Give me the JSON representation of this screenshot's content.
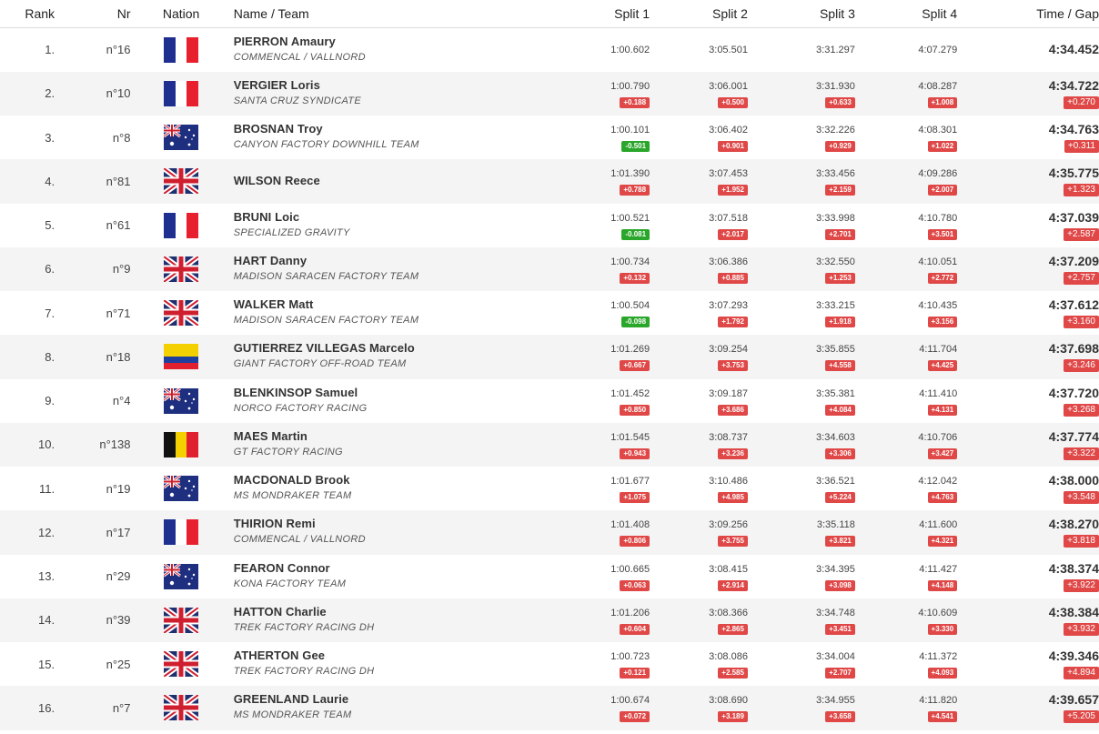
{
  "headers": {
    "rank": "Rank",
    "nr": "Nr",
    "nation": "Nation",
    "name_team": "Name / Team",
    "split1": "Split 1",
    "split2": "Split 2",
    "split3": "Split 3",
    "split4": "Split 4",
    "time_gap": "Time / Gap"
  },
  "rows": [
    {
      "rank": "1.",
      "nr": "n°16",
      "nation": "france-flag-icon",
      "name": "PIERRON Amaury",
      "team": "COMMENCAL / VALLNORD",
      "s1": "1:00.602",
      "g1": "",
      "g1_type": "",
      "s2": "3:05.501",
      "g2": "",
      "s3": "3:31.297",
      "g3": "",
      "s4": "4:07.279",
      "g4": "",
      "time": "4:34.452",
      "gap": ""
    },
    {
      "rank": "2.",
      "nr": "n°10",
      "nation": "france-flag-icon",
      "name": "VERGIER Loris",
      "team": "SANTA CRUZ SYNDICATE",
      "s1": "1:00.790",
      "g1": "+0.188",
      "g1_type": "plus",
      "s2": "3:06.001",
      "g2": "+0.500",
      "s3": "3:31.930",
      "g3": "+0.633",
      "s4": "4:08.287",
      "g4": "+1.008",
      "time": "4:34.722",
      "gap": "+0.270"
    },
    {
      "rank": "3.",
      "nr": "n°8",
      "nation": "australia-flag-icon",
      "name": "BROSNAN Troy",
      "team": "CANYON FACTORY DOWNHILL TEAM",
      "s1": "1:00.101",
      "g1": "-0.501",
      "g1_type": "minus",
      "s2": "3:06.402",
      "g2": "+0.901",
      "s3": "3:32.226",
      "g3": "+0.929",
      "s4": "4:08.301",
      "g4": "+1.022",
      "time": "4:34.763",
      "gap": "+0.311"
    },
    {
      "rank": "4.",
      "nr": "n°81",
      "nation": "uk-flag-icon",
      "name": "WILSON Reece",
      "team": "",
      "s1": "1:01.390",
      "g1": "+0.788",
      "g1_type": "plus",
      "s2": "3:07.453",
      "g2": "+1.952",
      "s3": "3:33.456",
      "g3": "+2.159",
      "s4": "4:09.286",
      "g4": "+2.007",
      "time": "4:35.775",
      "gap": "+1.323"
    },
    {
      "rank": "5.",
      "nr": "n°61",
      "nation": "france-flag-icon",
      "name": "BRUNI Loic",
      "team": "SPECIALIZED GRAVITY",
      "s1": "1:00.521",
      "g1": "-0.081",
      "g1_type": "minus",
      "s2": "3:07.518",
      "g2": "+2.017",
      "s3": "3:33.998",
      "g3": "+2.701",
      "s4": "4:10.780",
      "g4": "+3.501",
      "time": "4:37.039",
      "gap": "+2.587"
    },
    {
      "rank": "6.",
      "nr": "n°9",
      "nation": "uk-flag-icon",
      "name": "HART Danny",
      "team": "MADISON SARACEN FACTORY TEAM",
      "s1": "1:00.734",
      "g1": "+0.132",
      "g1_type": "plus",
      "s2": "3:06.386",
      "g2": "+0.885",
      "s3": "3:32.550",
      "g3": "+1.253",
      "s4": "4:10.051",
      "g4": "+2.772",
      "time": "4:37.209",
      "gap": "+2.757"
    },
    {
      "rank": "7.",
      "nr": "n°71",
      "nation": "uk-flag-icon",
      "name": "WALKER Matt",
      "team": "MADISON SARACEN FACTORY TEAM",
      "s1": "1:00.504",
      "g1": "-0.098",
      "g1_type": "minus",
      "s2": "3:07.293",
      "g2": "+1.792",
      "s3": "3:33.215",
      "g3": "+1.918",
      "s4": "4:10.435",
      "g4": "+3.156",
      "time": "4:37.612",
      "gap": "+3.160"
    },
    {
      "rank": "8.",
      "nr": "n°18",
      "nation": "colombia-flag-icon",
      "name": "GUTIERREZ VILLEGAS Marcelo",
      "team": "GIANT FACTORY OFF-ROAD TEAM",
      "s1": "1:01.269",
      "g1": "+0.667",
      "g1_type": "plus",
      "s2": "3:09.254",
      "g2": "+3.753",
      "s3": "3:35.855",
      "g3": "+4.558",
      "s4": "4:11.704",
      "g4": "+4.425",
      "time": "4:37.698",
      "gap": "+3.246"
    },
    {
      "rank": "9.",
      "nr": "n°4",
      "nation": "australia-flag-icon",
      "name": "BLENKINSOP Samuel",
      "team": "NORCO FACTORY RACING",
      "s1": "1:01.452",
      "g1": "+0.850",
      "g1_type": "plus",
      "s2": "3:09.187",
      "g2": "+3.686",
      "s3": "3:35.381",
      "g3": "+4.084",
      "s4": "4:11.410",
      "g4": "+4.131",
      "time": "4:37.720",
      "gap": "+3.268"
    },
    {
      "rank": "10.",
      "nr": "n°138",
      "nation": "belgium-flag-icon",
      "name": "MAES Martin",
      "team": "GT FACTORY RACING",
      "s1": "1:01.545",
      "g1": "+0.943",
      "g1_type": "plus",
      "s2": "3:08.737",
      "g2": "+3.236",
      "s3": "3:34.603",
      "g3": "+3.306",
      "s4": "4:10.706",
      "g4": "+3.427",
      "time": "4:37.774",
      "gap": "+3.322"
    },
    {
      "rank": "11.",
      "nr": "n°19",
      "nation": "australia-flag-icon",
      "name": "MACDONALD Brook",
      "team": "MS MONDRAKER TEAM",
      "s1": "1:01.677",
      "g1": "+1.075",
      "g1_type": "plus",
      "s2": "3:10.486",
      "g2": "+4.985",
      "s3": "3:36.521",
      "g3": "+5.224",
      "s4": "4:12.042",
      "g4": "+4.763",
      "time": "4:38.000",
      "gap": "+3.548"
    },
    {
      "rank": "12.",
      "nr": "n°17",
      "nation": "france-flag-icon",
      "name": "THIRION Remi",
      "team": "COMMENCAL / VALLNORD",
      "s1": "1:01.408",
      "g1": "+0.806",
      "g1_type": "plus",
      "s2": "3:09.256",
      "g2": "+3.755",
      "s3": "3:35.118",
      "g3": "+3.821",
      "s4": "4:11.600",
      "g4": "+4.321",
      "time": "4:38.270",
      "gap": "+3.818"
    },
    {
      "rank": "13.",
      "nr": "n°29",
      "nation": "australia-flag-icon",
      "name": "FEARON Connor",
      "team": "KONA FACTORY TEAM",
      "s1": "1:00.665",
      "g1": "+0.063",
      "g1_type": "plus",
      "s2": "3:08.415",
      "g2": "+2.914",
      "s3": "3:34.395",
      "g3": "+3.098",
      "s4": "4:11.427",
      "g4": "+4.148",
      "time": "4:38.374",
      "gap": "+3.922"
    },
    {
      "rank": "14.",
      "nr": "n°39",
      "nation": "uk-flag-icon",
      "name": "HATTON Charlie",
      "team": "TREK FACTORY RACING DH",
      "s1": "1:01.206",
      "g1": "+0.604",
      "g1_type": "plus",
      "s2": "3:08.366",
      "g2": "+2.865",
      "s3": "3:34.748",
      "g3": "+3.451",
      "s4": "4:10.609",
      "g4": "+3.330",
      "time": "4:38.384",
      "gap": "+3.932"
    },
    {
      "rank": "15.",
      "nr": "n°25",
      "nation": "uk-flag-icon",
      "name": "ATHERTON Gee",
      "team": "TREK FACTORY RACING DH",
      "s1": "1:00.723",
      "g1": "+0.121",
      "g1_type": "plus",
      "s2": "3:08.086",
      "g2": "+2.585",
      "s3": "3:34.004",
      "g3": "+2.707",
      "s4": "4:11.372",
      "g4": "+4.093",
      "time": "4:39.346",
      "gap": "+4.894"
    },
    {
      "rank": "16.",
      "nr": "n°7",
      "nation": "uk-flag-icon",
      "name": "GREENLAND Laurie",
      "team": "MS MONDRAKER TEAM",
      "s1": "1:00.674",
      "g1": "+0.072",
      "g1_type": "plus",
      "s2": "3:08.690",
      "g2": "+3.189",
      "s3": "3:34.955",
      "g3": "+3.658",
      "s4": "4:11.820",
      "g4": "+4.541",
      "time": "4:39.657",
      "gap": "+5.205"
    }
  ]
}
